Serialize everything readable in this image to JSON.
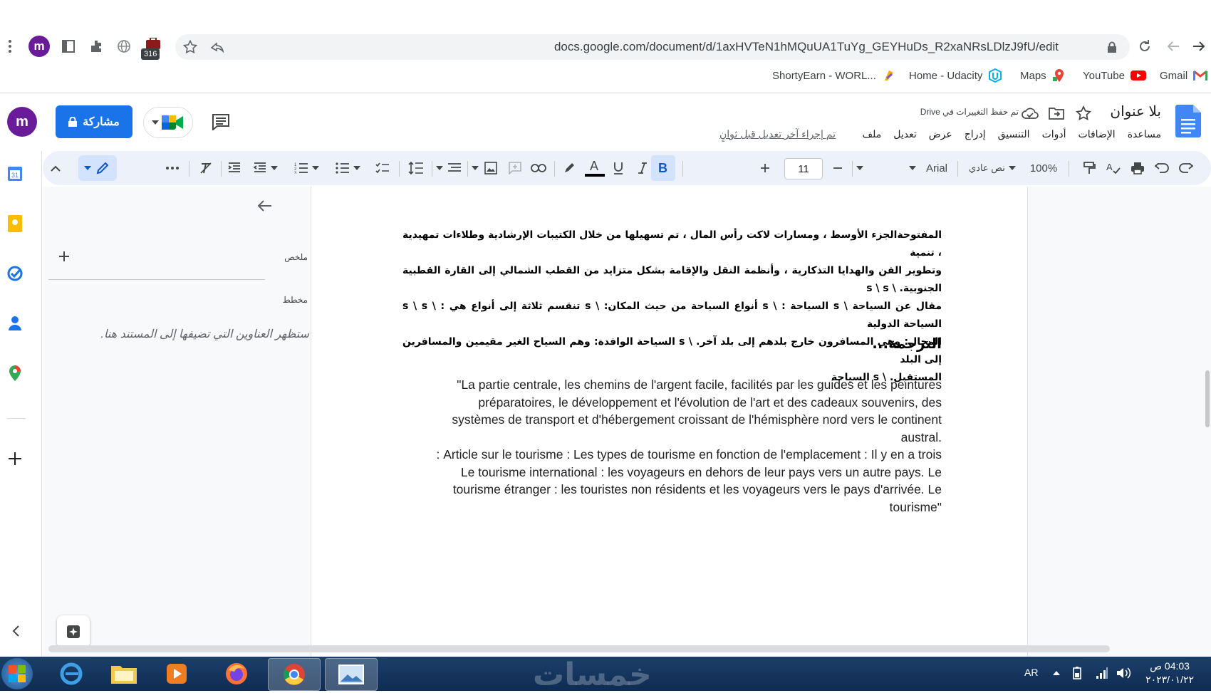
{
  "browser": {
    "url": "docs.google.com/document/d/1axHVTeN1hMQuUA1TuYg_GEYHuDs_R2xaNRsLDlzJ9fU/edit",
    "profile_initial": "m",
    "extension_badge": "316",
    "bookmarks": [
      {
        "label": "ShortyEarn - WORL...",
        "icon": "shortyearn-icon"
      },
      {
        "label": "Home - Udacity",
        "icon": "udacity-icon"
      },
      {
        "label": "Maps",
        "icon": "maps-icon"
      },
      {
        "label": "YouTube",
        "icon": "youtube-icon"
      },
      {
        "label": "Gmail",
        "icon": "gmail-icon"
      }
    ]
  },
  "docs": {
    "title": "بلا عنوان",
    "save_status": "تم حفظ التغييرات في Drive",
    "share_label": "مشاركة",
    "user_initial": "m",
    "last_edit": "تم إجراء آخر تعديل قبل ثوانٍ",
    "menu": [
      "ملف",
      "تعديل",
      "عرض",
      "إدراج",
      "التنسيق",
      "أدوات",
      "الإضافات",
      "مساعدة"
    ]
  },
  "toolbar": {
    "zoom": "100%",
    "style": "نص عادي",
    "font": "Arial",
    "font_size": "11"
  },
  "outline": {
    "summary_label": "ملخص",
    "outline_label": "مخطط",
    "placeholder": "ستظهر العناوين التي تضيفها إلى المستند هنا."
  },
  "document": {
    "arabic_lines": [
      "المفتوحةالجزء الأوسط ، ومسارات لاكت رأس المال ، تم تسهيلها من خلال الكتيبات الإرشادية وطلاءات تمهيدية ، تنمية",
      "وتطوير الفن والهدايا التذكارية ، وأنظمة النقل والإقامة بشكل متزايد من القطب الشمالي إلى القارة القطبية الجنوبية. \\ s \\ s",
      "مقال عن السياحة \\ s السياحة : \\ s أنواع السياحة من حيث المكان: \\ s تنقسم ثلاثة إلى أنواع هي : \\ s \\ s السياحة الدولية",
      "المجال: وهي المسافرون خارج بلدهم إلى بلد آخر. \\ s السياحة الوافدة: وهم السياح الغير مقيمين والمسافرين إلى البلد",
      "المستقبل. \\ s السياحة"
    ],
    "heading": "الترجمة...",
    "french_lines": [
      "La partie centrale, les chemins de l'argent facile, facilités par les guides et les peintures\"",
      "préparatoires, le développement et l'évolution de l'art et des cadeaux souvenirs, des",
      "systèmes de transport et d'hébergement croissant de l'hémisphère nord vers le continent",
      ".austral",
      "Article sur le tourisme : Les types de tourisme en fonction de l'emplacement : Il y en a trois :",
      "Le tourisme international : les voyageurs en dehors de leur pays vers un autre pays. Le",
      "tourisme étranger : les touristes non résidents et les voyageurs vers le pays d'arrivée. Le",
      "\"tourisme"
    ]
  },
  "taskbar": {
    "language": "AR",
    "time": "04:03 ص",
    "date": "٢٠٢٣/٠١/٢٢",
    "watermark": "خمسات"
  }
}
